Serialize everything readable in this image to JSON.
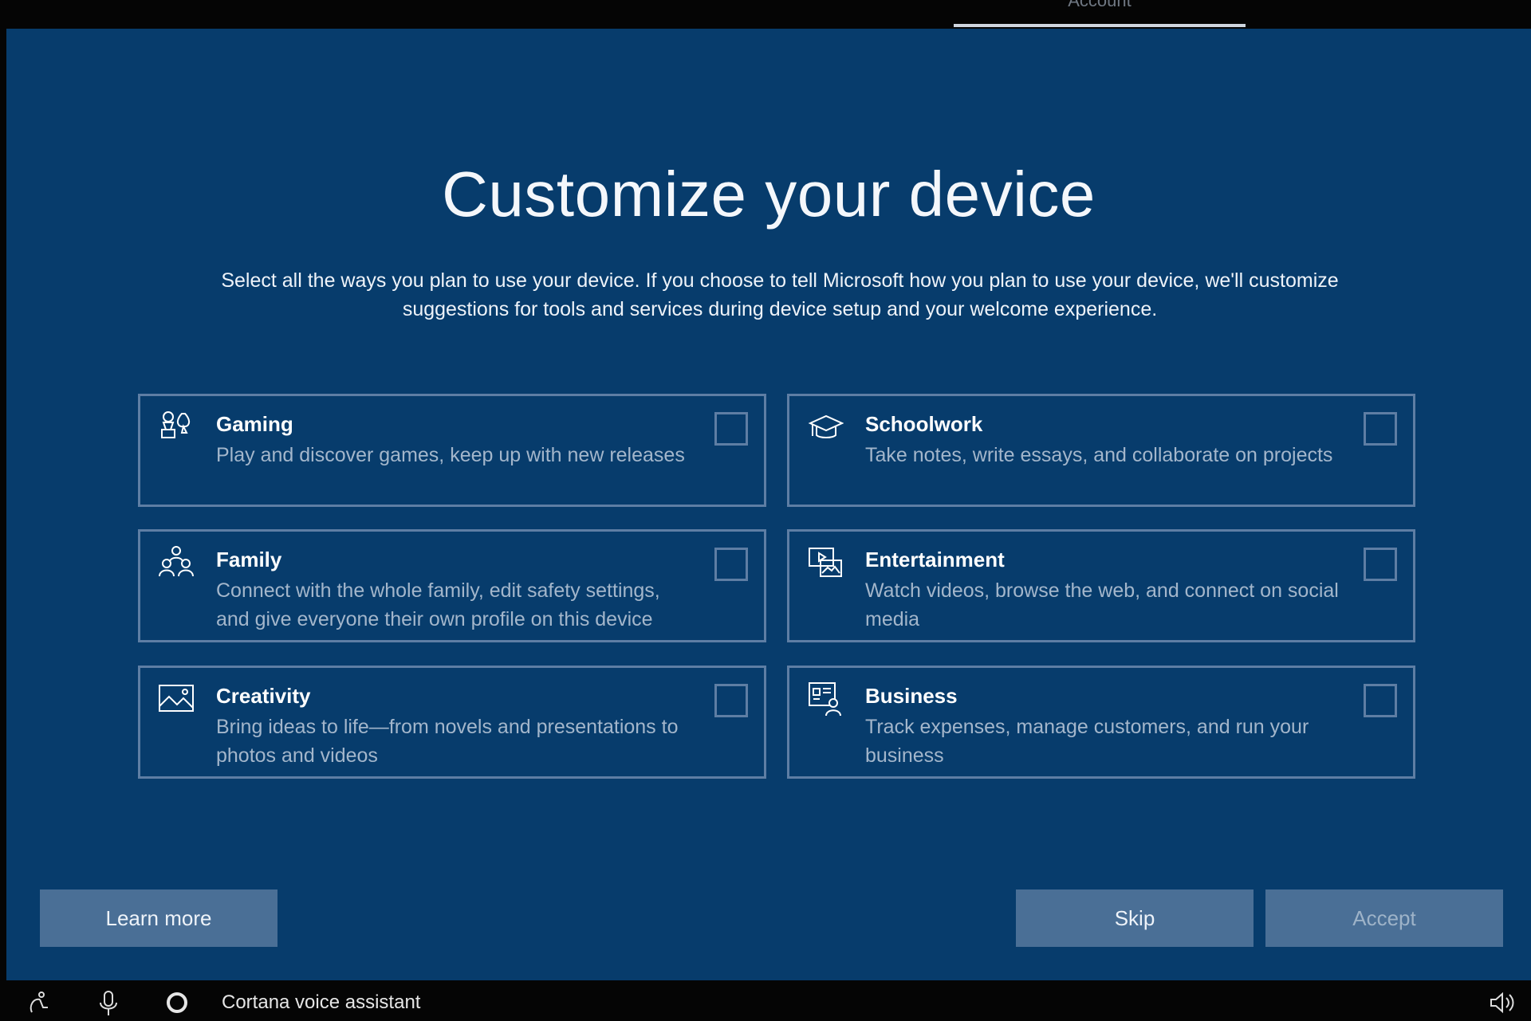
{
  "top_tab": {
    "label": "Account"
  },
  "header": {
    "title": "Customize your device",
    "subtitle": "Select all the ways you plan to use your device. If you choose to tell Microsoft how you plan to use your device, we'll customize suggestions for tools and services during device setup and your welcome experience."
  },
  "options": [
    {
      "title": "Gaming",
      "description": "Play and discover games, keep up with new releases",
      "icon": "gaming-icon",
      "checked": false
    },
    {
      "title": "Schoolwork",
      "description": "Take notes, write essays, and collaborate on projects",
      "icon": "graduation-cap-icon",
      "checked": false
    },
    {
      "title": "Family",
      "description": "Connect with the whole family, edit safety settings, and give everyone their own profile on this device",
      "icon": "family-icon",
      "checked": false
    },
    {
      "title": "Entertainment",
      "description": "Watch videos, browse the web, and connect on social media",
      "icon": "entertainment-icon",
      "checked": false
    },
    {
      "title": "Creativity",
      "description": "Bring ideas to life—from novels and presentations to photos and videos",
      "icon": "picture-icon",
      "checked": false
    },
    {
      "title": "Business",
      "description": "Track expenses, manage customers, and run your business",
      "icon": "business-icon",
      "checked": false
    }
  ],
  "footer": {
    "learn_more": "Learn more",
    "skip": "Skip",
    "accept": "Accept"
  },
  "taskbar": {
    "cortana_label": "Cortana voice assistant",
    "icons": [
      "accessibility-icon",
      "microphone-icon",
      "cortana-icon",
      "volume-icon"
    ]
  },
  "colors": {
    "background": "#073c6c",
    "card_border": "#5e7ea4",
    "button": "#4a6f96",
    "description_text": "#a3b6cb"
  }
}
